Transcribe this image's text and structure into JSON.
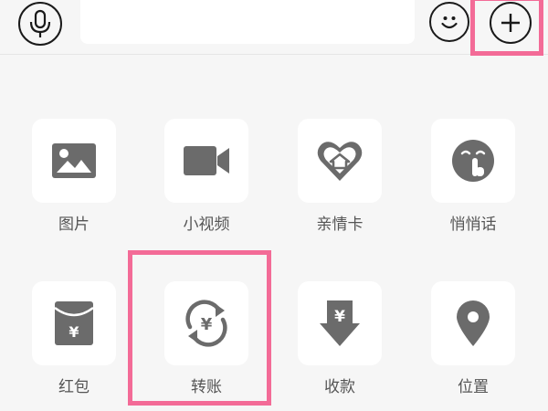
{
  "input_bar": {
    "voice_icon": "microphone-icon",
    "text_placeholder": "",
    "emoji_icon": "smiley-icon",
    "plus_icon": "plus-icon"
  },
  "features": [
    {
      "id": "picture",
      "label": "图片",
      "icon": "image-icon"
    },
    {
      "id": "short-video",
      "label": "小视频",
      "icon": "video-camera-icon"
    },
    {
      "id": "family-card",
      "label": "亲情卡",
      "icon": "heart-home-icon"
    },
    {
      "id": "whisper",
      "label": "悄悄话",
      "icon": "shush-face-icon"
    },
    {
      "id": "red-packet",
      "label": "红包",
      "icon": "red-packet-icon"
    },
    {
      "id": "transfer",
      "label": "转账",
      "icon": "yuan-transfer-icon"
    },
    {
      "id": "receive-money",
      "label": "收款",
      "icon": "yuan-download-icon"
    },
    {
      "id": "location",
      "label": "位置",
      "icon": "location-pin-icon"
    }
  ],
  "colors": {
    "background": "#f6f6f6",
    "tile": "#ffffff",
    "icon": "#6b6b6b",
    "label": "#555555",
    "highlight": "#f36b97"
  }
}
